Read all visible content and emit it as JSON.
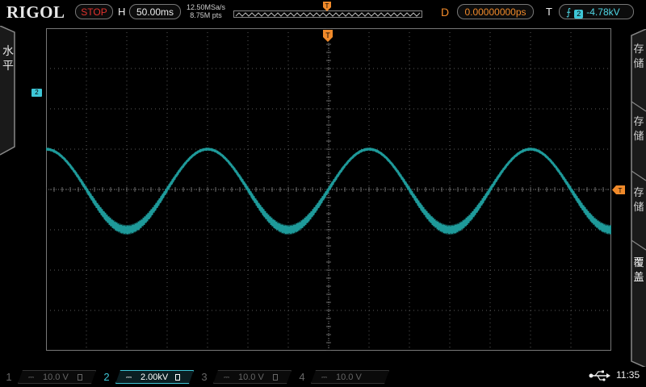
{
  "header": {
    "logo": "RIGOL",
    "run_state": "STOP",
    "horizontal_label": "H",
    "timebase": "50.00ms",
    "sample_rate": "12.50MSa/s",
    "memory_depth": "8.75M pts",
    "delay_label": "D",
    "delay": "0.00000000ps",
    "trigger_label": "T",
    "trigger_source": "2",
    "trigger_level": "-4.78kV"
  },
  "left_panel": {
    "label": "水平"
  },
  "right_panel": {
    "items": [
      {
        "label": "存储"
      },
      {
        "label": "存储"
      },
      {
        "label": "存储"
      },
      {
        "label": "覆盖"
      }
    ]
  },
  "markers": {
    "channel_marker": "2",
    "trigger_marker": "T",
    "trigger_position": "T"
  },
  "bottom": {
    "channels": [
      {
        "num": "1",
        "coupling": "⎓",
        "volts": "10.0 V"
      },
      {
        "num": "2",
        "coupling": "⎓",
        "volts": "2.00kV"
      },
      {
        "num": "3",
        "coupling": "⎓",
        "volts": "10.0 V"
      },
      {
        "num": "4",
        "coupling": "⎓",
        "volts": "10.0 V"
      }
    ],
    "time": "11:35"
  },
  "colors": {
    "ch2": "#1e9a9a",
    "trigger": "#f08a2a",
    "stop": "#e0322e"
  },
  "icons": [
    "trigger-edge-icon",
    "usb-icon",
    "bandwidth-limit-icon"
  ]
}
